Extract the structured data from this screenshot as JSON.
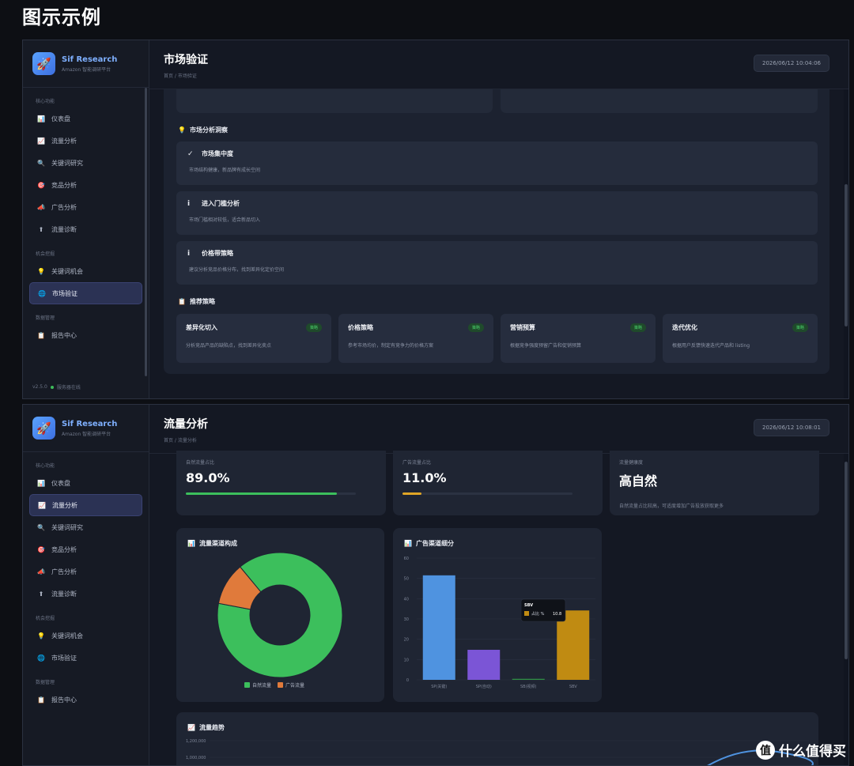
{
  "page_heading": "图示示例",
  "brand": {
    "name": "Sif Research",
    "subtitle": "Amazon 智能调研平台",
    "logo_icon": "rocket-icon"
  },
  "sidebar": {
    "groups": [
      {
        "label": "核心功能",
        "items": [
          {
            "icon": "📊",
            "label": "仪表盘"
          },
          {
            "icon": "📈",
            "label": "流量分析"
          },
          {
            "icon": "🔍",
            "label": "关键词研究"
          },
          {
            "icon": "🎯",
            "label": "竞品分析"
          },
          {
            "icon": "📣",
            "label": "广告分析"
          },
          {
            "icon": "⬆",
            "label": "流量诊断"
          }
        ]
      },
      {
        "label": "机会挖掘",
        "items": [
          {
            "icon": "💡",
            "label": "关键词机会"
          },
          {
            "icon": "🌐",
            "label": "市场验证"
          }
        ]
      },
      {
        "label": "数据管理",
        "items": [
          {
            "icon": "📋",
            "label": "报告中心"
          }
        ]
      }
    ],
    "footer_version": "v2.5.0",
    "footer_status": "服务器在线"
  },
  "window_a": {
    "title": "市场验证",
    "breadcrumb": "首页 / 市场验证",
    "timestamp": "2026/06/12 10:04:06",
    "active_item": "市场验证",
    "insights_title": "市场分析洞察",
    "insights": [
      {
        "icon": "✓",
        "title": "市场集中度",
        "desc": "市场结构健康，新品牌有成长空间",
        "accent": "green"
      },
      {
        "icon": "i",
        "title": "进入门槛分析",
        "desc": "市场门槛相对较低，适合新品切入",
        "accent": "cyan"
      },
      {
        "icon": "i",
        "title": "价格带策略",
        "desc": "建议分析竞品价格分布，找到差异化定价空间",
        "accent": "cyan"
      }
    ],
    "strategies_title": "推荐策略",
    "strategies": [
      {
        "name": "差异化切入",
        "badge": "策略",
        "desc": "分析竞品产品的缺陷点，找到差异化卖点"
      },
      {
        "name": "价格策略",
        "badge": "策略",
        "desc": "参考市场均价，制定有竞争力的价格方案"
      },
      {
        "name": "营销预算",
        "badge": "策略",
        "desc": "根据竞争强度预留广告和促销预算"
      },
      {
        "name": "迭代优化",
        "badge": "策略",
        "desc": "根据用户反馈快速迭代产品和 listing"
      }
    ]
  },
  "window_b": {
    "title": "流量分析",
    "breadcrumb": "首页 / 流量分析",
    "timestamp": "2026/06/12 10:08:01",
    "active_item": "流量分析",
    "kpis": [
      {
        "label": "自然流量占比",
        "value": "89.0%",
        "progress": 0.89,
        "color": "#3cbf5c"
      },
      {
        "label": "广告流量占比",
        "value": "11.0%",
        "progress": 0.11,
        "color": "#e0a526"
      },
      {
        "label": "流量健康度",
        "value": "高自然",
        "note": "自然流量占比较高，可适度增加广告投放获取更多"
      }
    ],
    "donut_title": "流量渠道构成",
    "bar_title": "广告渠道细分",
    "trend_title": "流量趋势",
    "trend_ticks": [
      "1,200,000",
      "1,000,000"
    ],
    "tooltip": {
      "title": "SBV",
      "series": "占比 %",
      "value": "10.8"
    }
  },
  "colors": {
    "green": "#3cbf5c",
    "orange": "#e07a3b",
    "blue": "#4f93e0",
    "purple": "#7b55d6",
    "gold": "#c08b12",
    "darkgreen": "#2f8f45"
  },
  "chart_data": [
    {
      "type": "pie",
      "title": "流量渠道构成",
      "categories": [
        "自然流量",
        "广告流量"
      ],
      "values": [
        89.0,
        11.0
      ],
      "colors": [
        "#3cbf5c",
        "#e07a3b"
      ],
      "legend": "bottom"
    },
    {
      "type": "bar",
      "title": "广告渠道细分",
      "categories": [
        "SP(关键)",
        "SP(自动)",
        "SB(视频)",
        "SBV"
      ],
      "values": [
        51.5,
        14.8,
        0.5,
        34.2
      ],
      "colors": [
        "#4f93e0",
        "#7b55d6",
        "#2f8f45",
        "#c08b12"
      ],
      "ylim": [
        0,
        60
      ],
      "yticks": [
        0,
        10,
        20,
        30,
        40,
        50,
        60
      ],
      "grid": true
    }
  ],
  "watermark": {
    "text": "什么值得买",
    "icon": "值"
  }
}
